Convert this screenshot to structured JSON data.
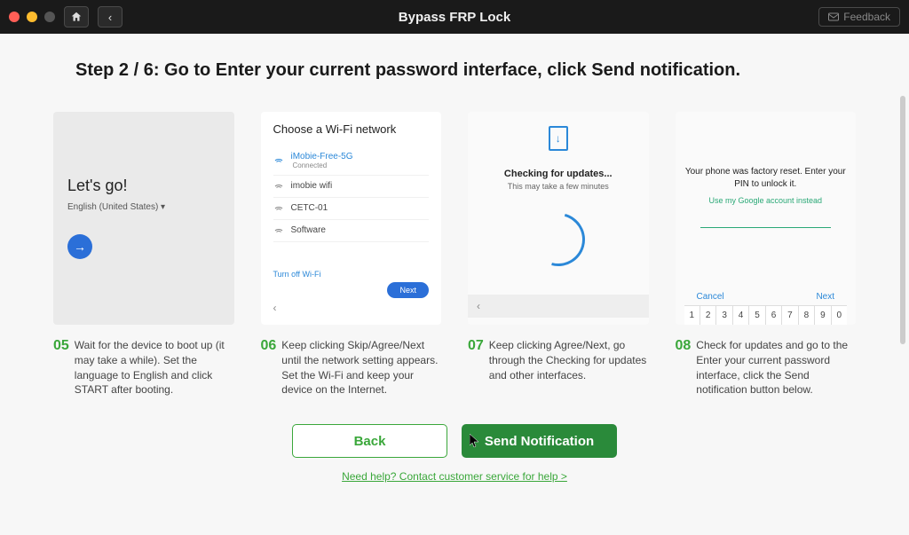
{
  "titlebar": {
    "title": "Bypass FRP Lock",
    "feedback": "Feedback"
  },
  "heading": "Step 2 / 6: Go to Enter your current password interface, click Send notification.",
  "cards": {
    "c5": {
      "title": "Let's go!",
      "lang": "English (United States)  ▾"
    },
    "c6": {
      "title": "Choose a Wi-Fi network",
      "item1": "iMobie-Free-5G",
      "item1sub": "Connected",
      "item2": "imobie wifi",
      "item3": "CETC-01",
      "item4": "Software",
      "turnoff": "Turn off Wi-Fi",
      "next": "Next",
      "back": "‹"
    },
    "c7": {
      "title": "Checking for updates...",
      "sub": "This may  take a few minutes",
      "back": "‹"
    },
    "c8": {
      "line1": "Your phone was factory reset. Enter your PIN to unlock it.",
      "link": "Use my Google account instead",
      "cancel": "Cancel",
      "next": "Next",
      "keys": [
        "1",
        "2",
        "3",
        "4",
        "5",
        "6",
        "7",
        "8",
        "9",
        "0"
      ]
    }
  },
  "desc": {
    "n5": "05",
    "t5": "Wait for the device to boot up (it may take a while). Set the language to English and click START after booting.",
    "n6": "06",
    "t6": "Keep clicking Skip/Agree/Next until the network setting appears. Set the Wi-Fi and keep your device on the Internet.",
    "n7": "07",
    "t7": "Keep clicking Agree/Next, go through the Checking for updates and other interfaces.",
    "n8": "08",
    "t8": "Check for updates and go to the Enter your current password interface, click the Send notification button below."
  },
  "buttons": {
    "back": "Back",
    "send": "Send Notification"
  },
  "help": "Need help? Contact customer service for help >"
}
